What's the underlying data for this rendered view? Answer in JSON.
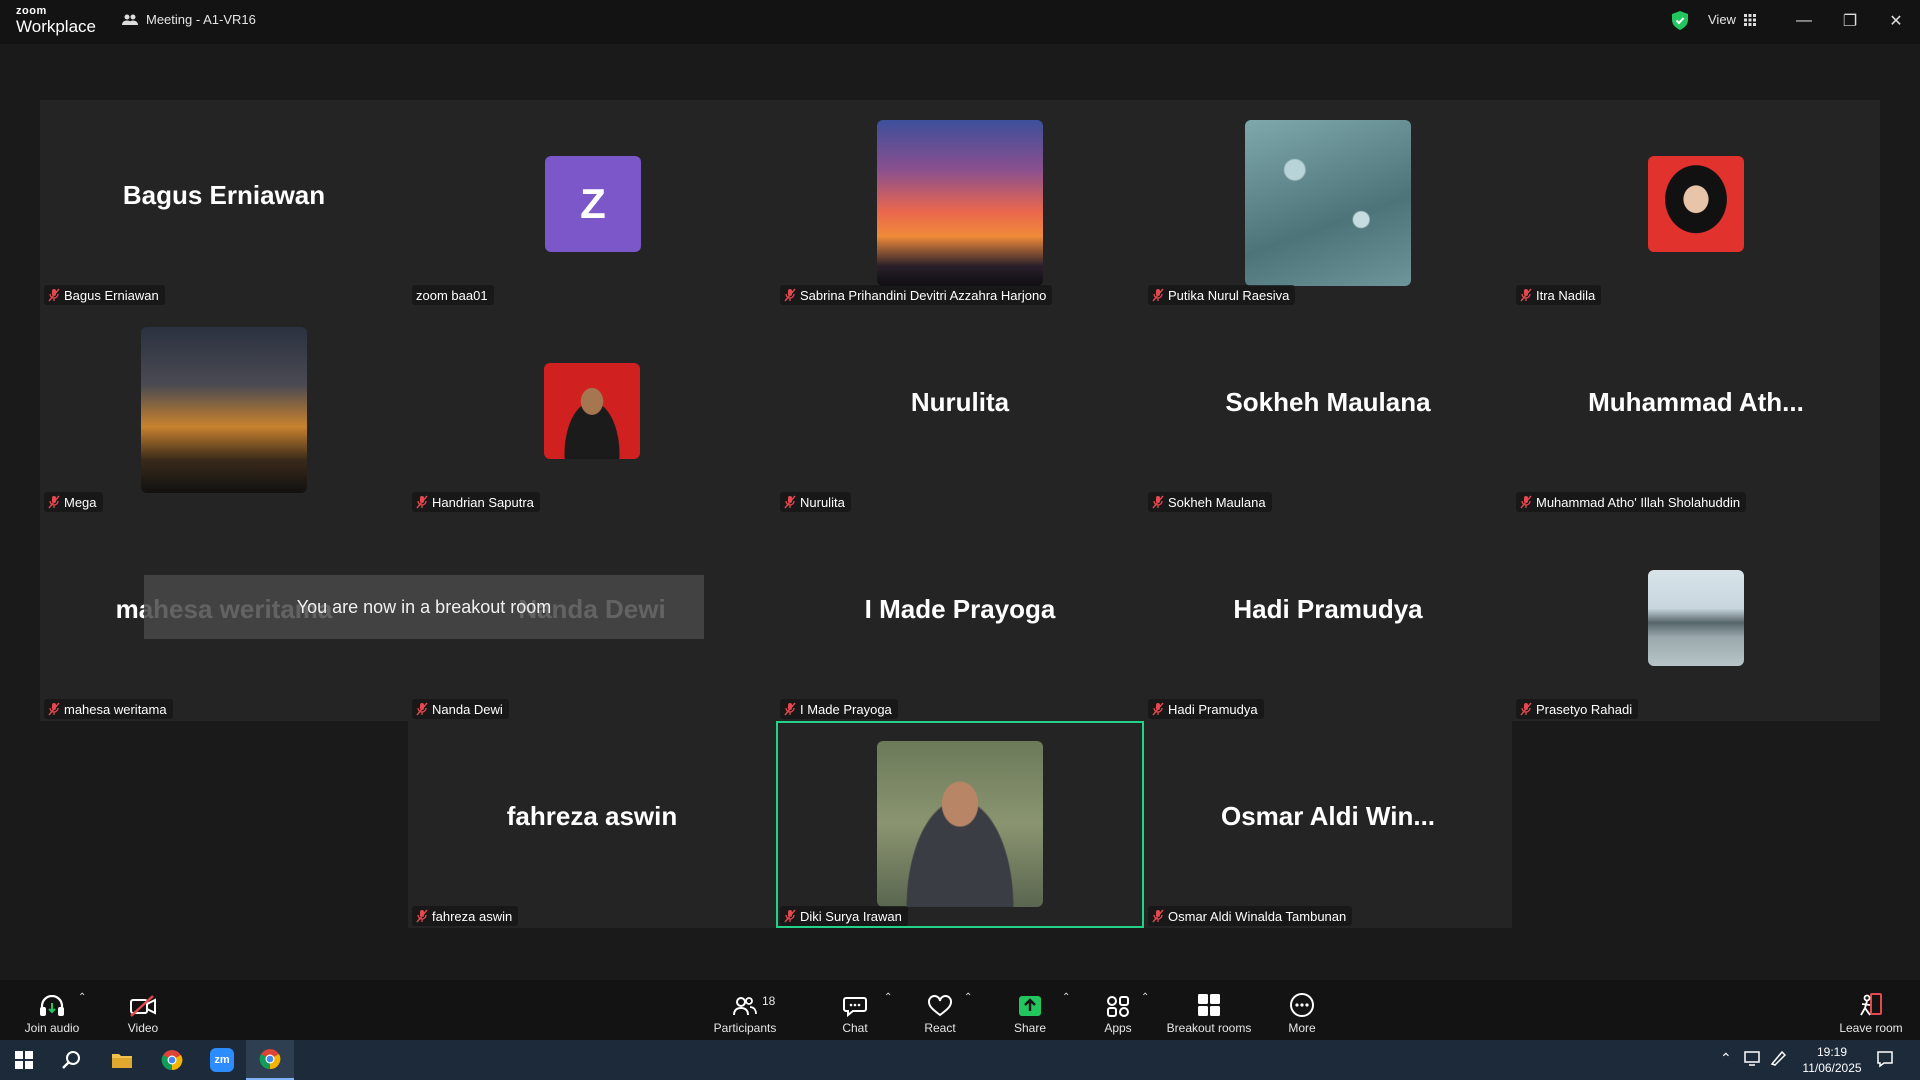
{
  "titlebar": {
    "brand_line1": "zoom",
    "brand_line2": "Workplace",
    "meeting_title": "Meeting - A1-VR16",
    "view_label": "View"
  },
  "toast": "You are now in a breakout room",
  "tiles": [
    {
      "name": "Bagus Erniawan",
      "display": "Bagus Erniawan",
      "type": "text"
    },
    {
      "name": "zoom baa01",
      "display": "Z",
      "type": "avatar",
      "muted": false
    },
    {
      "name": "Sabrina Prihandini Devitri Azzahra Harjono",
      "type": "photo",
      "photo": "sunset-sky"
    },
    {
      "name": "Putika Nurul Raesiva",
      "type": "photo",
      "photo": "water-drops"
    },
    {
      "name": "Itra Nadila",
      "type": "photo",
      "photo": "portrait-hijab"
    },
    {
      "name": "Mega",
      "type": "photo",
      "photo": "dusk-clouds"
    },
    {
      "name": "Handrian Saputra",
      "type": "photo",
      "photo": "portrait-red-bg"
    },
    {
      "name": "Nurulita",
      "display": "Nurulita",
      "type": "text"
    },
    {
      "name": "Sokheh Maulana",
      "display": "Sokheh Maulana",
      "type": "text"
    },
    {
      "name": "Muhammad Atho' Illah Sholahuddin",
      "display": "Muhammad  Ath...",
      "type": "text"
    },
    {
      "name": "mahesa weritama",
      "display": "mahesa weritama",
      "type": "text"
    },
    {
      "name": "Nanda Dewi",
      "display": "Nanda Dewi",
      "type": "text"
    },
    {
      "name": "I Made Prayoga",
      "display": "I Made Prayoga",
      "type": "text"
    },
    {
      "name": "Hadi Pramudya",
      "display": "Hadi Pramudya",
      "type": "text"
    },
    {
      "name": "Prasetyo Rahadi",
      "type": "photo",
      "photo": "beach-portrait"
    },
    {
      "name": "fahreza aswin",
      "display": "fahreza aswin",
      "type": "text"
    },
    {
      "name": "Diki Surya Irawan",
      "type": "photo",
      "photo": "portrait-suit",
      "active_speaker": true
    },
    {
      "name": "Osmar Aldi Winalda Tambunan",
      "display": "Osmar Aldi Win...",
      "type": "text"
    }
  ],
  "toolbar": {
    "join_audio": "Join audio",
    "video": "Video",
    "participants": "Participants",
    "participant_count": "18",
    "chat": "Chat",
    "react": "React",
    "share": "Share",
    "apps": "Apps",
    "breakout_rooms": "Breakout rooms",
    "more": "More",
    "leave_room": "Leave room"
  },
  "taskbar": {
    "time": "19:19",
    "date": "11/06/2025"
  },
  "colors": {
    "active_speaker": "#23d18b",
    "share_green": "#22c55e",
    "muted_red": "#e5484d",
    "avatar_purple": "#7b57c9"
  }
}
